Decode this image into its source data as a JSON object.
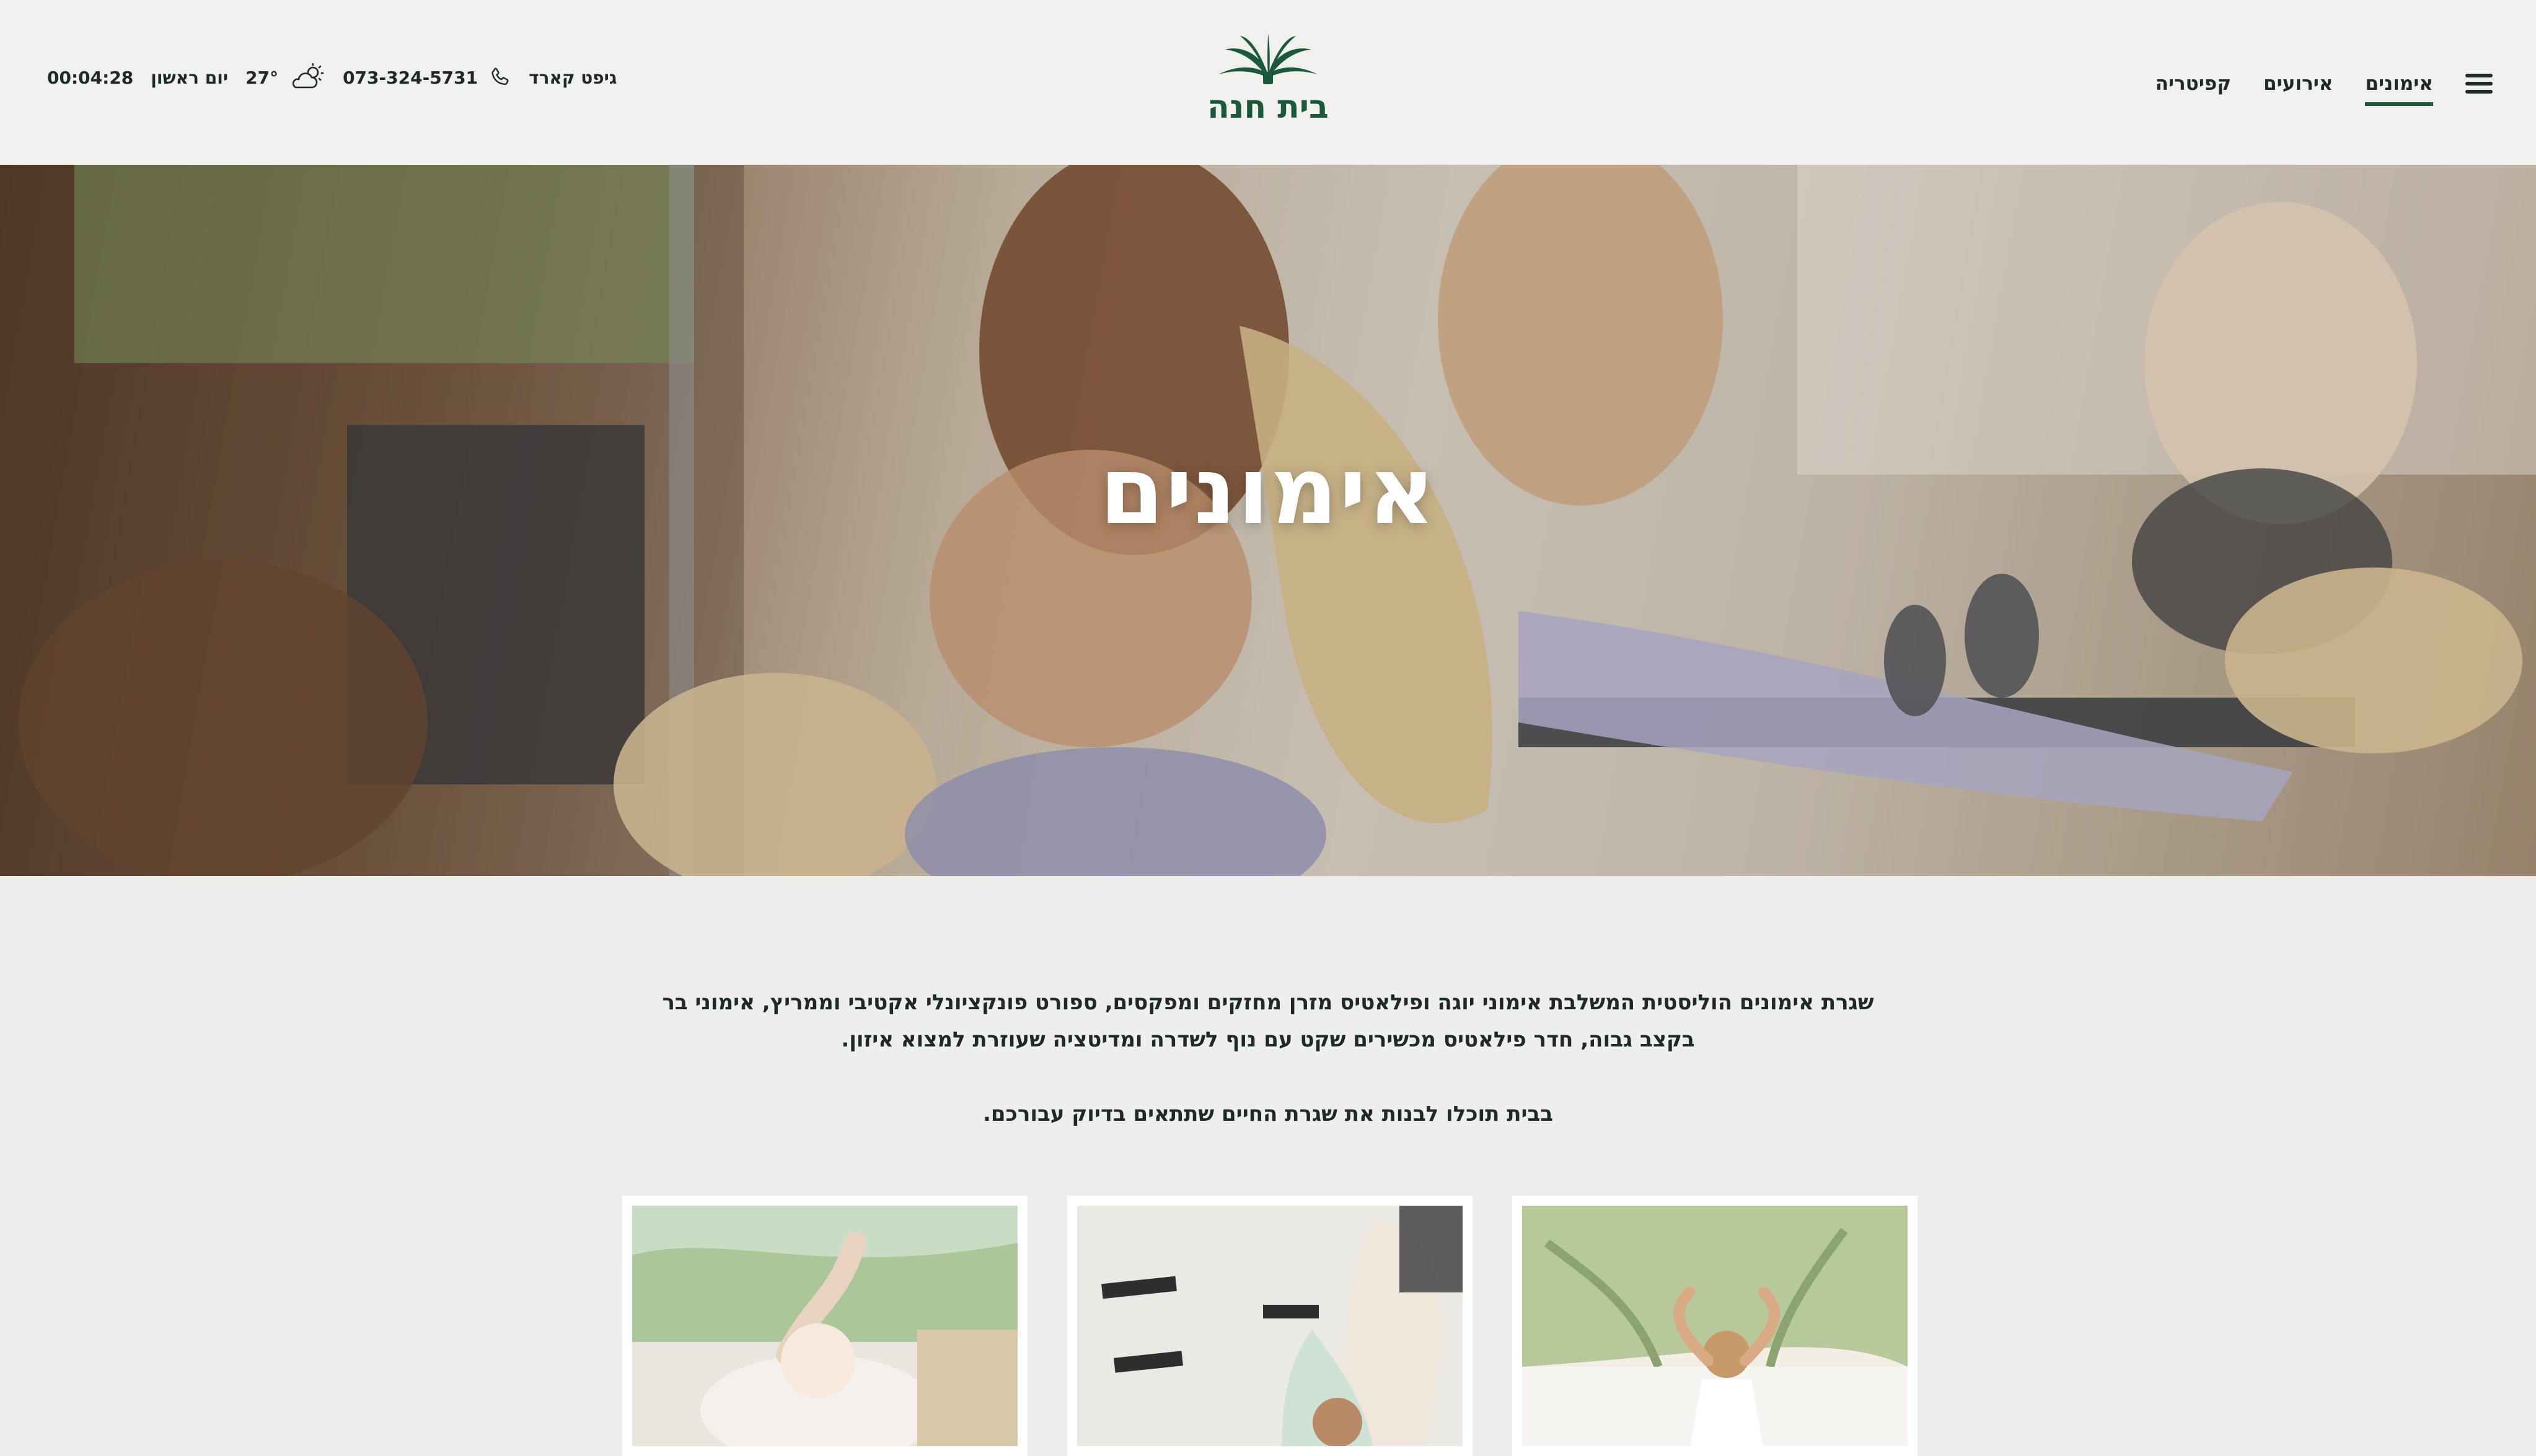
{
  "header": {
    "nav": [
      {
        "label": "אימונים",
        "active": true
      },
      {
        "label": "אירועים",
        "active": false
      },
      {
        "label": "קפיטריה",
        "active": false
      }
    ],
    "logo_text": "בית חנה",
    "gift_card": "גיפט קארד",
    "phone": "073-324-5731",
    "weather": {
      "temperature": "27°",
      "icon": "partly-cloudy-icon"
    },
    "day": "יום ראשון",
    "time": "00:04:28"
  },
  "hero": {
    "title": "אימונים"
  },
  "intro": {
    "paragraph1": "שגרת אימונים הוליסטית המשלבת אימוני יוגה ופילאטיס מזרן מחזקים ומפקסים, ספורט פונקציונלי אקטיבי וממריץ, אימוני בר בקצב גבוה, חדר פילאטיס מכשירים שקט עם נוף לשדרה ומדיטציה שעוזרת למצוא איזון.",
    "paragraph2": "בבית תוכלו לבנות את שגרת החיים שתתאים בדיוק עבורכם."
  },
  "colors": {
    "brand_green": "#1a5a3a",
    "text_dark": "#1f2a22",
    "background": "#eeeeec"
  }
}
